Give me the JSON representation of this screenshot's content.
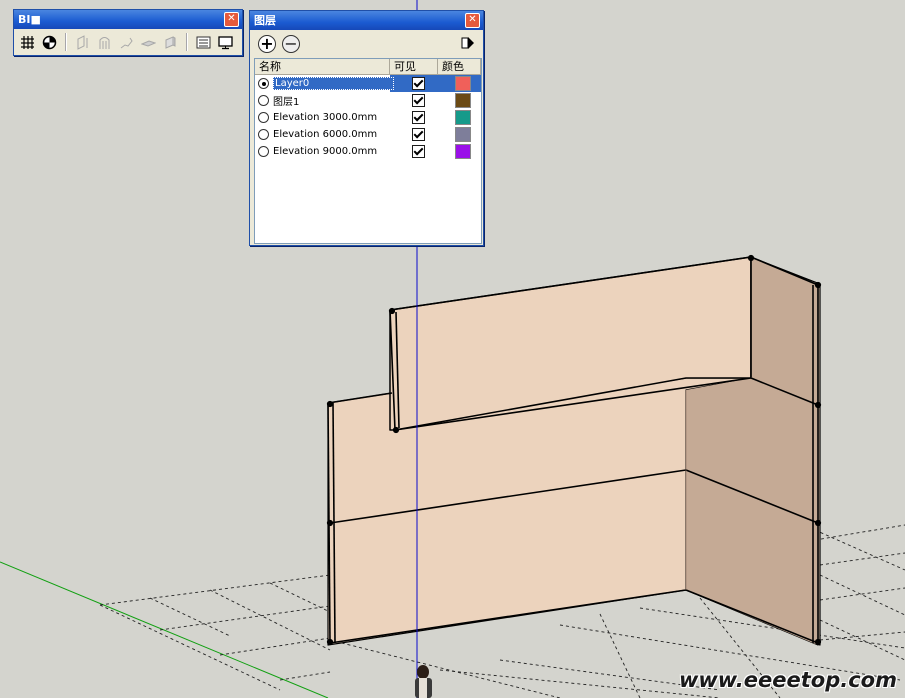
{
  "bim_toolbar": {
    "title": "BI■",
    "close_glyph": "✕",
    "icons": [
      "grid-icon",
      "section-icon",
      "column-icon",
      "arch-icon",
      "stair-icon",
      "slab-icon",
      "wall-icon",
      "list-icon",
      "monitor-icon"
    ]
  },
  "layers_panel": {
    "title": "图层",
    "close_glyph": "✕",
    "add_glyph": "+",
    "remove_glyph": "−",
    "columns": {
      "name": "名称",
      "visible": "可见",
      "color": "颜色"
    },
    "layers": [
      {
        "name": "Layer0",
        "active": true,
        "visible": true,
        "color": "#f0605a",
        "selected": true
      },
      {
        "name": "图层1",
        "active": false,
        "visible": true,
        "color": "#6b4a14",
        "selected": false
      },
      {
        "name": "Elevation 3000.0mm",
        "active": false,
        "visible": true,
        "color": "#169a8a",
        "selected": false
      },
      {
        "name": "Elevation 6000.0mm",
        "active": false,
        "visible": true,
        "color": "#7e7e9a",
        "selected": false
      },
      {
        "name": "Elevation 9000.0mm",
        "active": false,
        "visible": true,
        "color": "#9a10e8",
        "selected": false
      }
    ]
  },
  "scene": {
    "background": "#d4d4ce",
    "wall_front_color": "#ecd3bd",
    "wall_side_color": "#c5aa95",
    "blue_axis_color": "#0a0acc",
    "green_axis_color": "#12a012"
  },
  "watermark": "www.eeeetop.com"
}
